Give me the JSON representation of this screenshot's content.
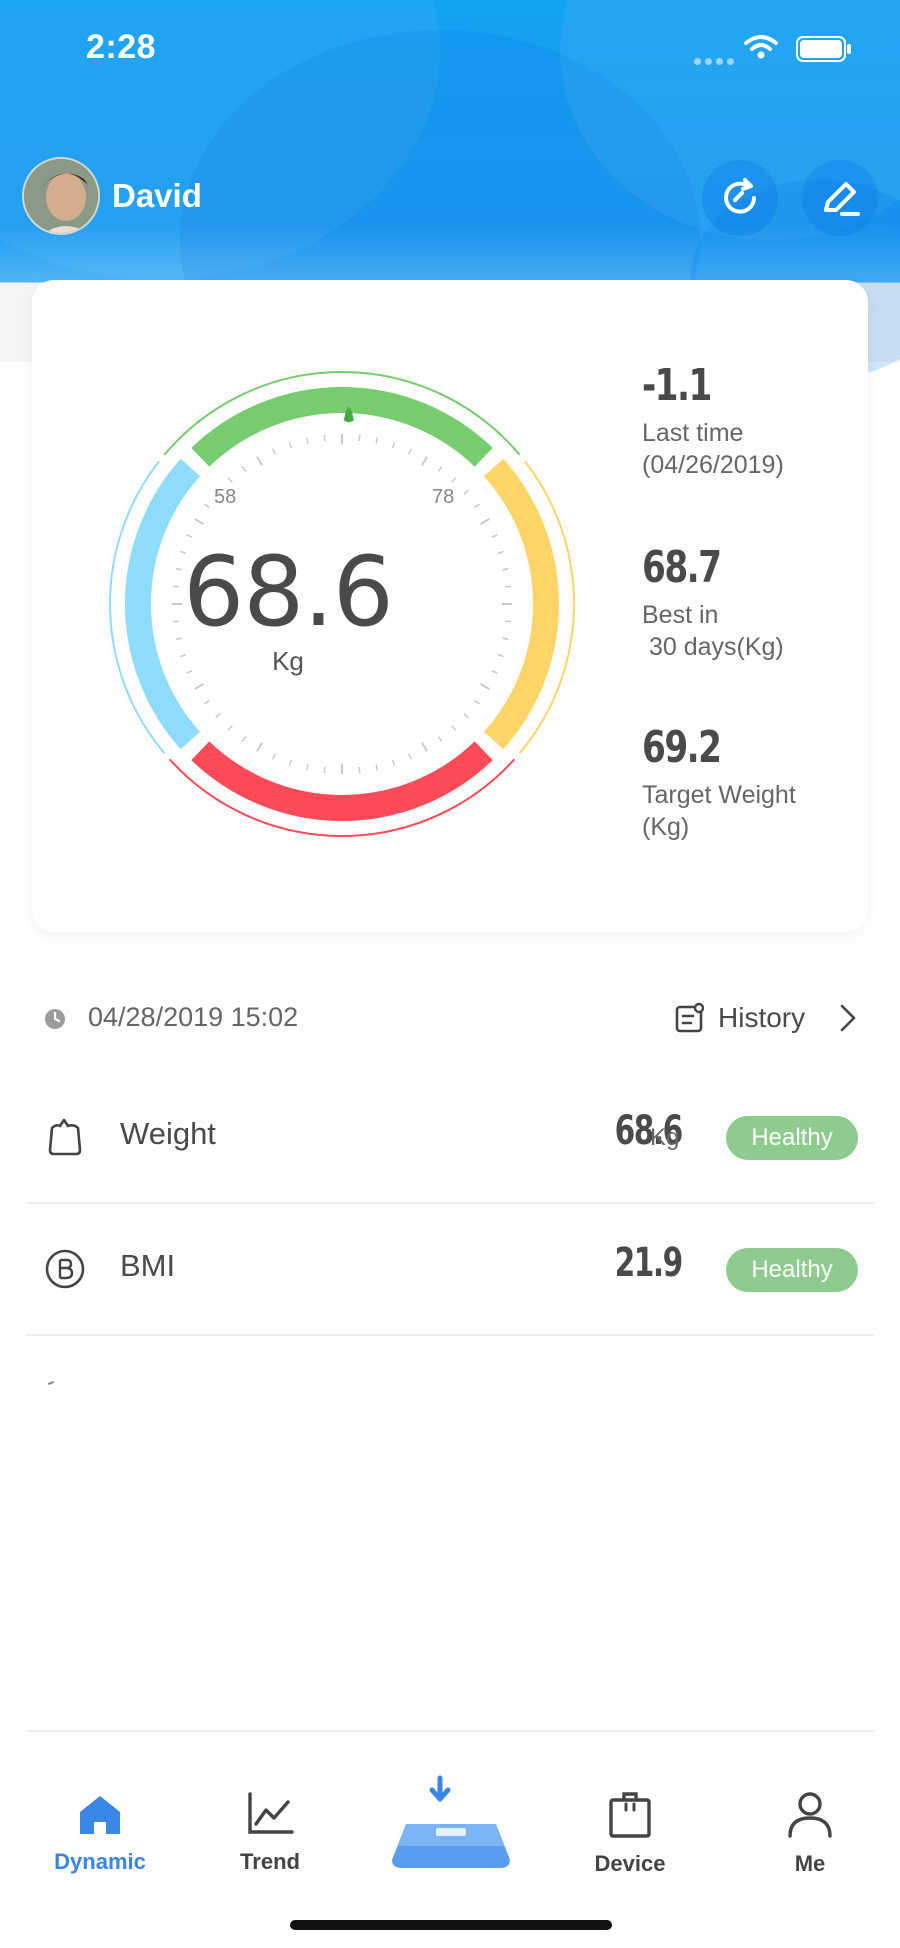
{
  "status_bar": {
    "time": "2:28"
  },
  "user": {
    "name": "David"
  },
  "gauge": {
    "value": "68.6",
    "unit": "Kg",
    "min_label": "58",
    "max_label": "78"
  },
  "stats": [
    {
      "value": "-1.1",
      "label": "Last time\n(04/26/2019)"
    },
    {
      "value": "68.7",
      "label": "Best in\n 30 days(Kg)"
    },
    {
      "value": "69.2",
      "label": "Target Weight\n(Kg)"
    }
  ],
  "record": {
    "datetime": "04/28/2019 15:02",
    "history_label": "History"
  },
  "metrics": {
    "weight": {
      "name": "Weight",
      "value": "68.6",
      "unit": "Kg",
      "status": "Healthy"
    },
    "bmi": {
      "name": "BMI",
      "value": "21.9",
      "status": "Healthy"
    }
  },
  "tabs": {
    "dynamic": "Dynamic",
    "trend": "Trend",
    "device": "Device",
    "me": "Me"
  },
  "colors": {
    "header_blue": "#14a2f2",
    "gauge_green": "#77cc70",
    "gauge_yellow": "#ffd56a",
    "gauge_red": "#fb4a58",
    "gauge_blue": "#8fdcfd",
    "healthy_badge": "#8ecb8e",
    "active_tab": "#3a86e6"
  },
  "icons": [
    "wifi-icon",
    "battery-icon",
    "refresh-icon",
    "edit-icon",
    "clock-icon",
    "history-icon",
    "chevron-right-icon",
    "weight-icon",
    "bmi-icon",
    "home-icon",
    "trend-icon",
    "scale-icon",
    "device-icon",
    "person-icon"
  ]
}
